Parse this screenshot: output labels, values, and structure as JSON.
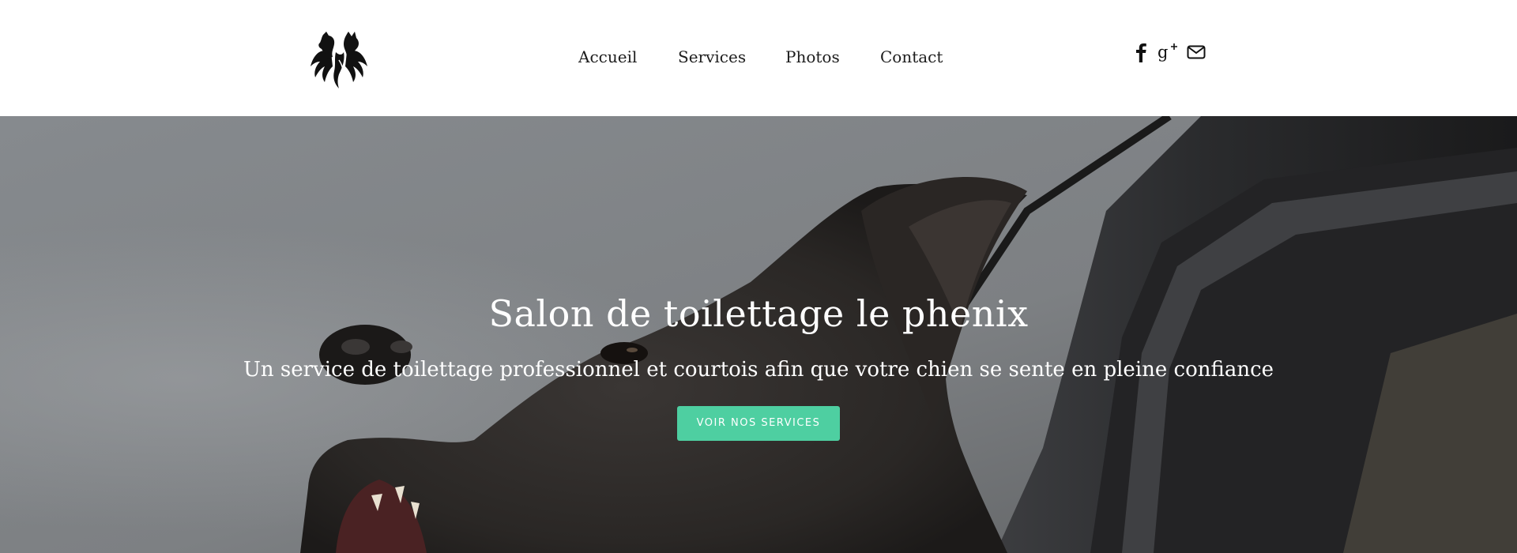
{
  "header": {
    "logo_name": "phoenix-dog-cat-logo",
    "nav": [
      {
        "label": "Accueil"
      },
      {
        "label": "Services"
      },
      {
        "label": "Photos"
      },
      {
        "label": "Contact"
      }
    ],
    "social": [
      {
        "icon": "facebook-icon"
      },
      {
        "icon": "google-plus-icon"
      },
      {
        "icon": "mail-icon"
      }
    ]
  },
  "hero": {
    "title": "Salon de toilettage le phenix",
    "subtitle": "Un service de toilettage professionnel et courtois afin que votre chien se sente en pleine confiance",
    "button_label": "Voir nos services",
    "button_color": "#4ecfa1"
  }
}
